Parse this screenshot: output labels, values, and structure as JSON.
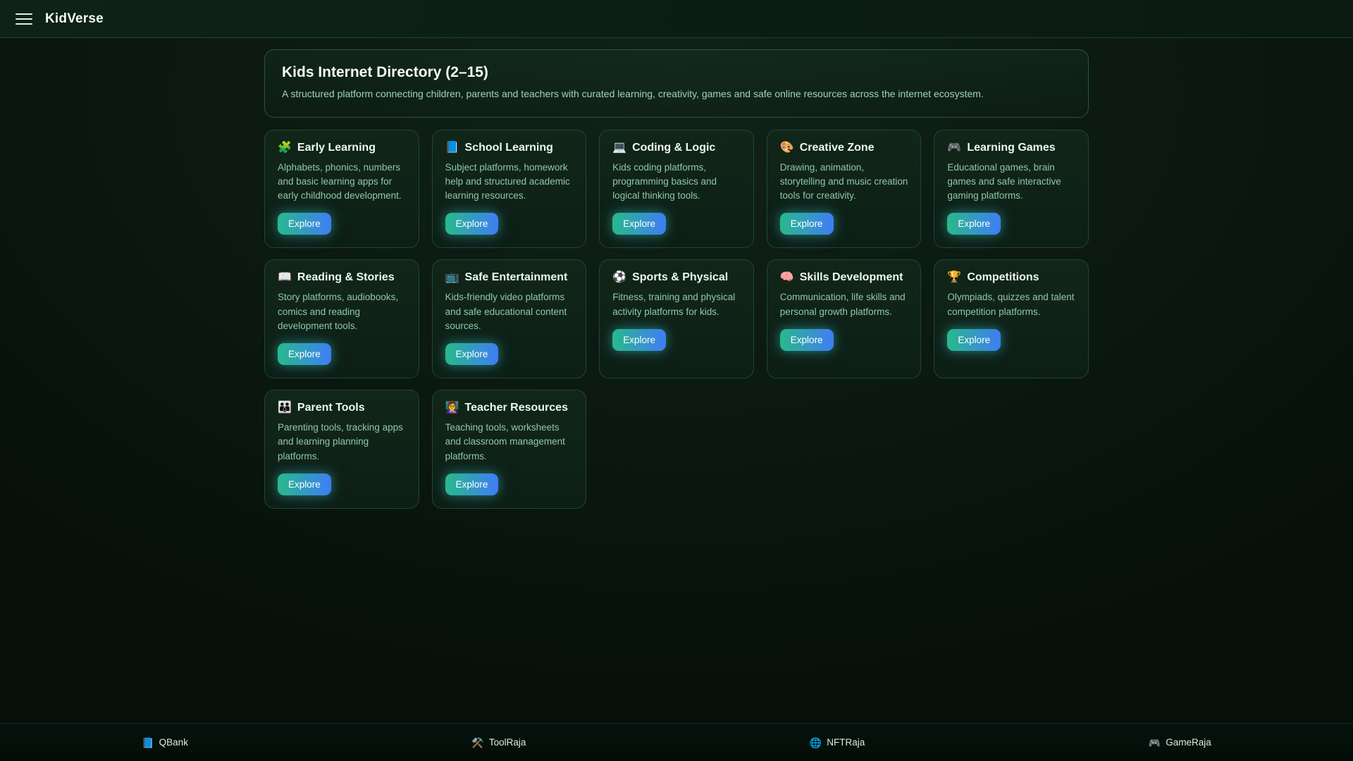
{
  "header": {
    "app_title": "KidVerse"
  },
  "hero": {
    "title": "Kids Internet Directory (2–15)",
    "subtitle": "A structured platform connecting children, parents and teachers with curated learning, creativity, games and safe online resources across the internet ecosystem."
  },
  "explore_label": "Explore",
  "cards": [
    {
      "slug": "early-learning",
      "emoji": "🧩",
      "title": "Early Learning",
      "description": "Alphabets, phonics, numbers and basic learning apps for early childhood development."
    },
    {
      "slug": "school-learning",
      "emoji": "📘",
      "title": "School Learning",
      "description": "Subject platforms, homework help and structured academic learning resources."
    },
    {
      "slug": "coding-logic",
      "emoji": "💻",
      "title": "Coding & Logic",
      "description": "Kids coding platforms, programming basics and logical thinking tools."
    },
    {
      "slug": "creative-zone",
      "emoji": "🎨",
      "title": "Creative Zone",
      "description": "Drawing, animation, storytelling and music creation tools for creativity."
    },
    {
      "slug": "learning-games",
      "emoji": "🎮",
      "title": "Learning Games",
      "description": "Educational games, brain games and safe interactive gaming platforms."
    },
    {
      "slug": "reading-stories",
      "emoji": "📖",
      "title": "Reading & Stories",
      "description": "Story platforms, audiobooks, comics and reading development tools."
    },
    {
      "slug": "safe-entertainment",
      "emoji": "📺",
      "title": "Safe Entertainment",
      "description": "Kids-friendly video platforms and safe educational content sources."
    },
    {
      "slug": "sports-physical",
      "emoji": "⚽",
      "title": "Sports & Physical",
      "description": "Fitness, training and physical activity platforms for kids."
    },
    {
      "slug": "skills-development",
      "emoji": "🧠",
      "title": "Skills Development",
      "description": "Communication, life skills and personal growth platforms."
    },
    {
      "slug": "competitions",
      "emoji": "🏆",
      "title": "Competitions",
      "description": "Olympiads, quizzes and talent competition platforms."
    },
    {
      "slug": "parent-tools",
      "emoji": "👪",
      "title": "Parent Tools",
      "description": "Parenting tools, tracking apps and learning planning platforms."
    },
    {
      "slug": "teacher-resources",
      "emoji": "👩‍🏫",
      "title": "Teacher Resources",
      "description": "Teaching tools, worksheets and classroom management platforms."
    }
  ],
  "footer": {
    "links": [
      {
        "slug": "qbank",
        "emoji": "📘",
        "label": "QBank"
      },
      {
        "slug": "toolraja",
        "emoji": "⚒️",
        "label": "ToolRaja"
      },
      {
        "slug": "nftraja",
        "emoji": "🌐",
        "label": "NFTRaja"
      },
      {
        "slug": "gameraja",
        "emoji": "🎮",
        "label": "GameRaja"
      }
    ]
  },
  "colors": {
    "accent_green": "#28b98b",
    "accent_blue": "#3f7df6",
    "page_bg_dark": "#0b1810"
  }
}
